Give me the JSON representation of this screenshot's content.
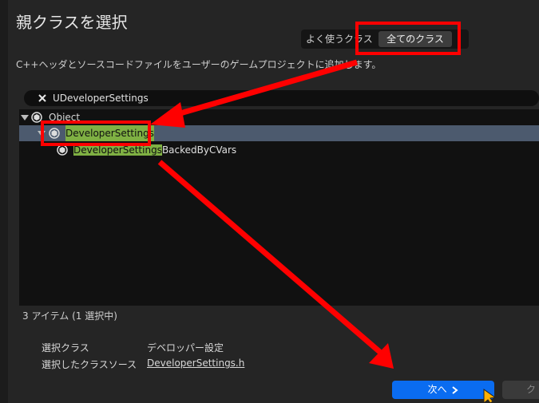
{
  "dialog": {
    "title": "親クラスを選択",
    "mode_common": "よく使うクラス",
    "mode_all": "全てのクラス",
    "description": "C++ヘッダとソースコードファイルをユーザーのゲームプロジェクトに追加します。"
  },
  "search": {
    "value": "UDeveloperSettings",
    "icon": "close-icon"
  },
  "tree": {
    "root": "Object",
    "selected_match": "DeveloperSettings",
    "child_match": "DeveloperSettings",
    "child_rest": "BackedByCVars",
    "icon": "class-icon"
  },
  "status": {
    "items": "3 アイテム (1 選択中)"
  },
  "info": {
    "class_label": "選択クラス",
    "class_value": "デベロッパー設定",
    "source_label": "選択したクラスソース",
    "source_value": "DeveloperSettings.h"
  },
  "buttons": {
    "next": "次へ",
    "next_icon": "chevron-right-icon",
    "cancel": "ク"
  },
  "colors": {
    "highlight": "#7fb043",
    "selected_row": "#4c5a6e",
    "accent": "#0a6cf0",
    "annotation": "#ff0000"
  }
}
